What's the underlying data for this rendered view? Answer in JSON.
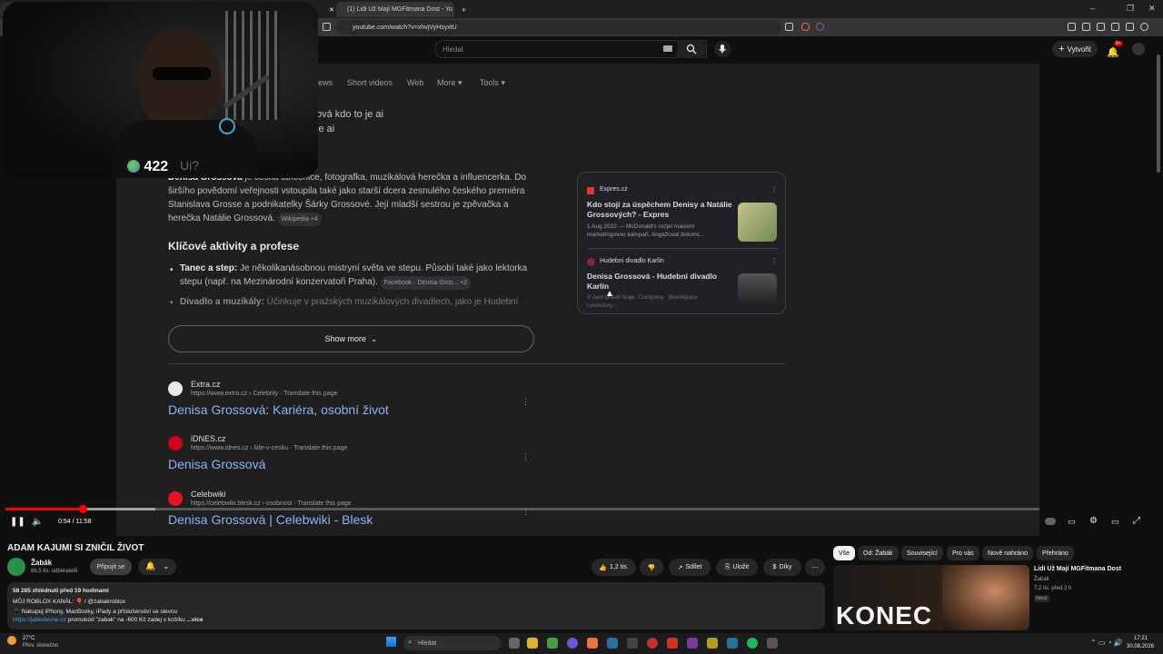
{
  "browser": {
    "tabs": [
      {
        "label": "(1) Lidi Už Mají MGFitmana Dost - Yo"
      },
      {
        "label": "+"
      }
    ],
    "url": "youtube.com/watch?v=xhvjVyHsyxtU",
    "time": "17:21",
    "date": "30.08.2026"
  },
  "youtube": {
    "search_placeholder": "Hledat",
    "create_label": "Vytvořit",
    "notif_count": "9+"
  },
  "serp": {
    "tabs": [
      "Short videos",
      "Web",
      "More",
      "Tools"
    ],
    "tab_partial": "ews",
    "ai_query_line1": "ová kdo to je ai",
    "ai_query_line2": "je ai",
    "ai_paragraph_bold": "Denisa Grossová",
    "ai_paragraph": "je česká tanečnice, fotografka, muzikálová herečka a influencerka. Do širšího povědomí veřejnosti vstoupila také jako starší dcera zesnulého českého premiéra Stanislava Grosse a podnikatelky Šárky Grossové. Její mladší sestrou je zpěvačka a herečka Natálie Grossová.",
    "ai_source_pill": "Wikipedia +4",
    "heading": "Klíčové aktivity a profese",
    "bullet1_bold": "Tanec a step:",
    "bullet1": "Je několikanásobnou mistryní světa ve stepu. Působí také jako lektorka stepu (např. na Mezinárodní konzervatoři Praha).",
    "bullet1_pill": "Facebook · Denisa Gros... +2",
    "bullet2_bold": "Divadlo a muzikály:",
    "bullet2": "Účinkuje v pražských muzikálových divadlech, jako je Hudební",
    "show_more": "Show more",
    "sources": [
      {
        "site": "Expres.cz",
        "title": "Kdo stojí za úspěchem Denisy a Natálie Grossových? - Expres",
        "snippet": "1 Aug 2022 — McDonald's rozjel masivní marketingovou kampaň. Angažoval dokonc..."
      },
      {
        "site": "Hudební divadlo Karlín",
        "title": "Denisa Grossová - Hudební divadlo Karlín",
        "snippet": "V čem právě hraje. Company · Beetlejuice · Lovestory..."
      }
    ],
    "results": [
      {
        "site": "Extra.cz",
        "url": "https://www.extra.cz › Celebrity",
        "translate": "Translate this page",
        "title": "Denisa Grossová: Kariéra, osobní život"
      },
      {
        "site": "iDNES.cz",
        "url": "https://www.idnes.cz › lide-v-cesku",
        "translate": "Translate this page",
        "title": "Denisa Grossová"
      },
      {
        "site": "Celebwiki",
        "url": "https://celebwiki.blesk.cz › osobnost",
        "translate": "Translate this page",
        "title": "Denisa Grossová | Celebwiki - Blesk"
      }
    ]
  },
  "stream": {
    "viewer_count": "422",
    "overlay_text": "Ui?"
  },
  "player": {
    "time": "0:54 / 11:58",
    "progress": 0.075
  },
  "video": {
    "title": "ADAM KAJUMI SI ZNIČIL ŽIVOT",
    "channel": "Žabák",
    "subscribers": "86,5 tis. odběratelů",
    "join_label": "Připojit se",
    "likes": "1,2 tis.",
    "share": "Sdílet",
    "save": "Uložit",
    "thanks": "Díky",
    "stats": "58 285 zhlédnutí  před 19 hodinami",
    "desc_line1": "MŮJ ROBLOX KANÁL: 🎈 / @zabakroblox",
    "desc_line2": "📱 Nakupuj iPhony, MacBooky, iPady a příslušenství se slevou",
    "desc_link": "https://jabkolevne.cz",
    "desc_line3": "promokód \"zabak\" na -600 Kč zadej v košíku",
    "desc_more": "...více"
  },
  "sidebar": {
    "chips": [
      "Vše",
      "Od: Žabák",
      "Související",
      "Pro vás",
      "Nově nahráno",
      "Přehráno"
    ],
    "rec_title": "Lidi Už Mají MGFitmana Dost",
    "rec_channel": "Žabák",
    "rec_meta": "7,2 tis.  před 2 h",
    "rec_badge": "Nový",
    "thumb_text": "KONEC"
  },
  "taskbar": {
    "weather_temp": "27°C",
    "weather_desc": "Přev. slunečno",
    "search": "Hledat"
  }
}
